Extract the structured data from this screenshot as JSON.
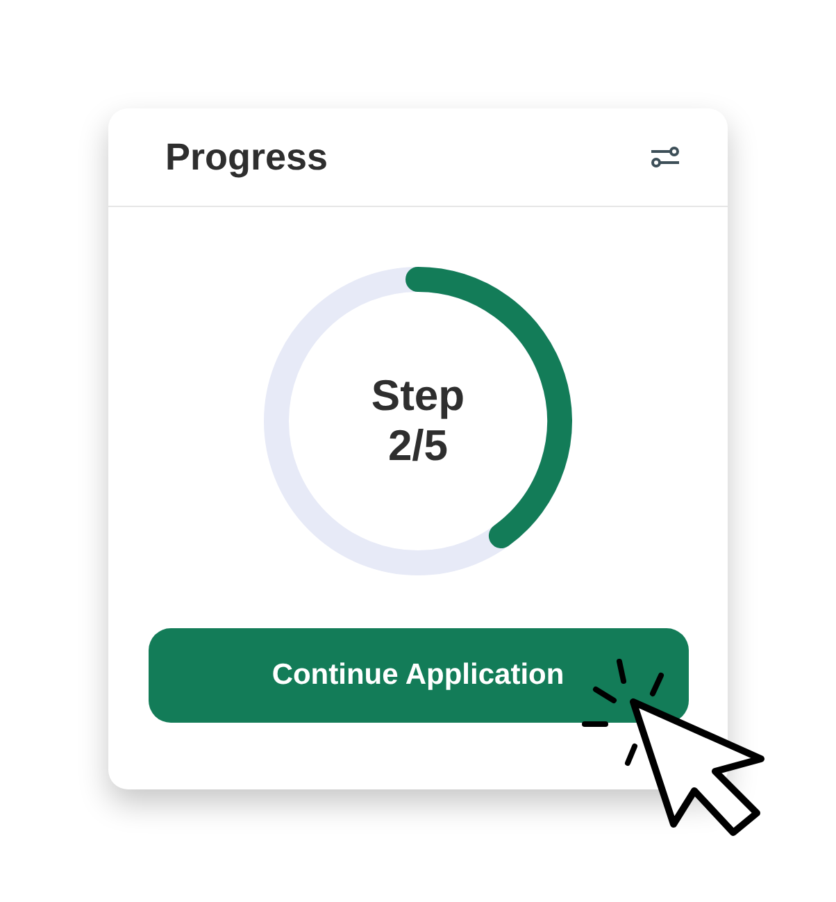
{
  "card": {
    "title": "Progress"
  },
  "progress": {
    "label_line_1": "Step",
    "label_line_2": "2/5"
  },
  "button": {
    "label": "Continue Application"
  }
}
